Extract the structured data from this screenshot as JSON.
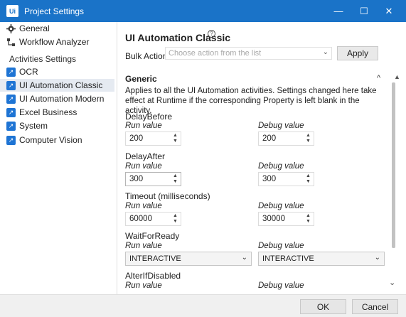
{
  "window": {
    "logo_text": "Ui",
    "title": "Project Settings",
    "minimize_glyph": "—",
    "maximize_glyph": "☐",
    "close_glyph": "✕"
  },
  "sidebar": {
    "items": [
      {
        "label": "General",
        "icon": "gear-icon"
      },
      {
        "label": "Workflow Analyzer",
        "icon": "workflow-icon"
      }
    ],
    "activities_heading": "Activities Settings",
    "activities": [
      {
        "label": "OCR",
        "icon": "activity-icon"
      },
      {
        "label": "UI Automation Classic",
        "icon": "activity-icon",
        "selected": true
      },
      {
        "label": "UI Automation Modern",
        "icon": "activity-icon"
      },
      {
        "label": "Excel Business",
        "icon": "activity-icon"
      },
      {
        "label": "System",
        "icon": "activity-icon"
      },
      {
        "label": "Computer Vision",
        "icon": "activity-icon"
      }
    ]
  },
  "main": {
    "title": "UI Automation Classic",
    "help_glyph": "?",
    "bulk_action_label": "Bulk Action",
    "bulk_action_placeholder": "Choose action from the list",
    "apply_label": "Apply",
    "section_title": "Generic",
    "section_description": "Applies to all the UI Automation activities. Settings changed here take effect at Runtime if the corresponding Property is left blank in the activity.",
    "run_value_label": "Run value",
    "debug_value_label": "Debug value",
    "properties": [
      {
        "name": "DelayBefore",
        "run": "200",
        "debug": "200"
      },
      {
        "name": "DelayAfter",
        "run": "300",
        "debug": "300"
      },
      {
        "name": "Timeout (milliseconds)",
        "run": "60000",
        "debug": "30000"
      },
      {
        "name": "WaitForReady",
        "run": "INTERACTIVE",
        "debug": "INTERACTIVE"
      },
      {
        "name": "AlterIfDisabled"
      }
    ]
  },
  "glyphs": {
    "chevron_down": "⌄",
    "chevron_up": "^",
    "spin_up": "▲",
    "spin_down": "▼"
  },
  "footer": {
    "ok_label": "OK",
    "cancel_label": "Cancel"
  }
}
